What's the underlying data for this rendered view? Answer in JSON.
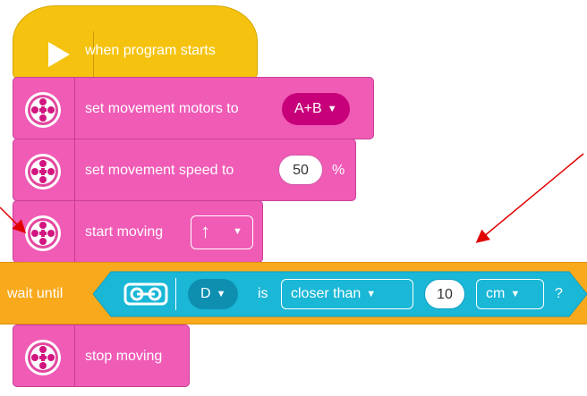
{
  "blocks": {
    "start": {
      "label": "when program starts"
    },
    "set_motors": {
      "label": "set movement motors to",
      "value": "A+B"
    },
    "set_speed": {
      "label": "set movement speed to",
      "value": "50",
      "unit": "%"
    },
    "start_moving": {
      "label": "start moving",
      "direction": "↑"
    },
    "wait_until": {
      "label": "wait until",
      "port": "D",
      "is_label": "is",
      "comparison": "closer than",
      "value": "10",
      "unit": "cm",
      "question": "?"
    },
    "stop_moving": {
      "label": "stop moving"
    }
  },
  "colors": {
    "events_yellow": "#f5c30f",
    "movement_pink": "#f05bb6",
    "control_orange": "#f9a91c",
    "sensor_cyan": "#1ab7d6",
    "arrow_red": "#e00000"
  },
  "icons": [
    "play-icon",
    "motor-wheel-icon",
    "distance-sensor-icon",
    "dropdown-caret-icon"
  ]
}
